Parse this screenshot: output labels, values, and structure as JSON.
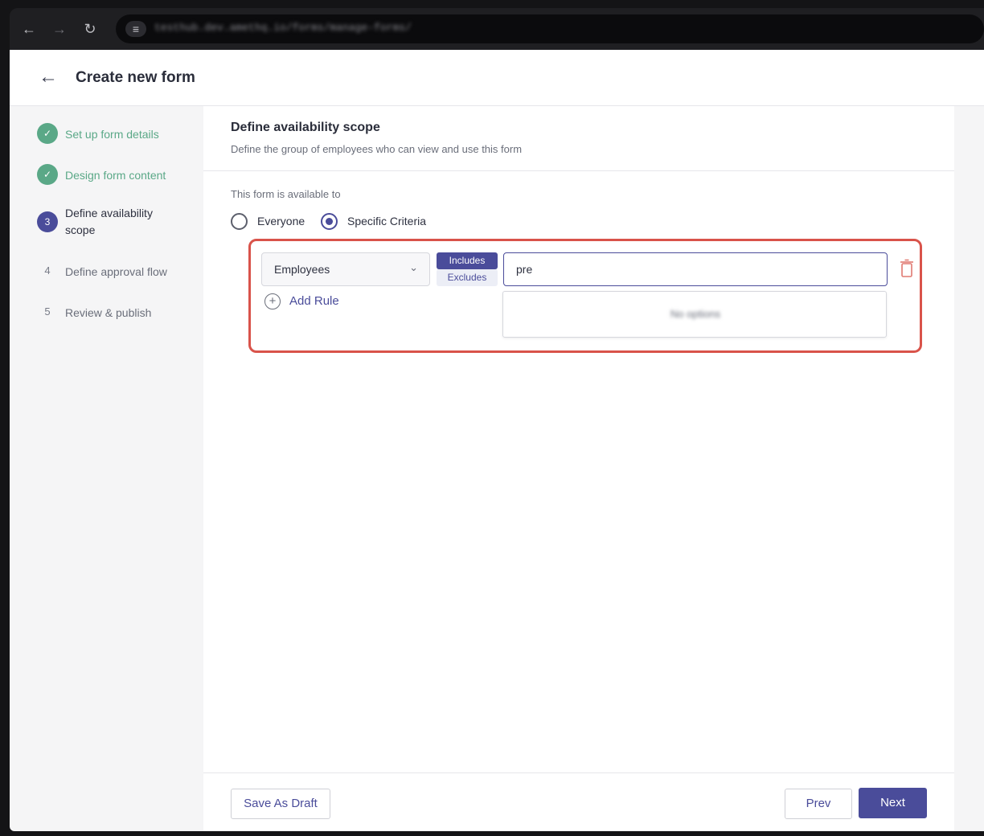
{
  "browser": {
    "back_icon": "arrow-left-icon",
    "forward_icon": "arrow-right-icon",
    "reload_icon": "reload-icon",
    "site_info_icon": "tune-icon",
    "url": "testhub.dev.amethq.io/forms/manage-forms/"
  },
  "header": {
    "back_icon": "arrow-left-icon",
    "title": "Create new form"
  },
  "stepper": {
    "steps": [
      {
        "marker": "✓",
        "label": "Set up form details",
        "state": "done"
      },
      {
        "marker": "✓",
        "label": "Design form content",
        "state": "done"
      },
      {
        "marker": "3",
        "label": "Define availability scope",
        "state": "active"
      },
      {
        "marker": "4",
        "label": "Define approval flow",
        "state": "todo"
      },
      {
        "marker": "5",
        "label": "Review & publish",
        "state": "todo"
      }
    ]
  },
  "scope": {
    "title": "Define availability scope",
    "subtitle": "Define the group of employees who can view and use this form",
    "available_label": "This form is available to",
    "options": {
      "everyone": {
        "label": "Everyone",
        "checked": false
      },
      "specific": {
        "label": "Specific Criteria",
        "checked": true
      }
    }
  },
  "rule": {
    "field_value": "Employees",
    "chevron_icon": "chevron-down-icon",
    "includes_label": "Includes",
    "excludes_label": "Excludes",
    "mode": "Includes",
    "search_value": "pre",
    "dropdown_text": "No options",
    "trash_icon": "trash-icon",
    "add_rule_label": "Add Rule",
    "add_rule_icon": "plus-circle-icon",
    "highlight_color": "#d9534a"
  },
  "footer": {
    "save_draft_label": "Save As Draft",
    "prev_label": "Prev",
    "next_label": "Next"
  },
  "colors": {
    "primary": "#4a4c9a",
    "success": "#5aa887",
    "danger": "#e07a72"
  }
}
